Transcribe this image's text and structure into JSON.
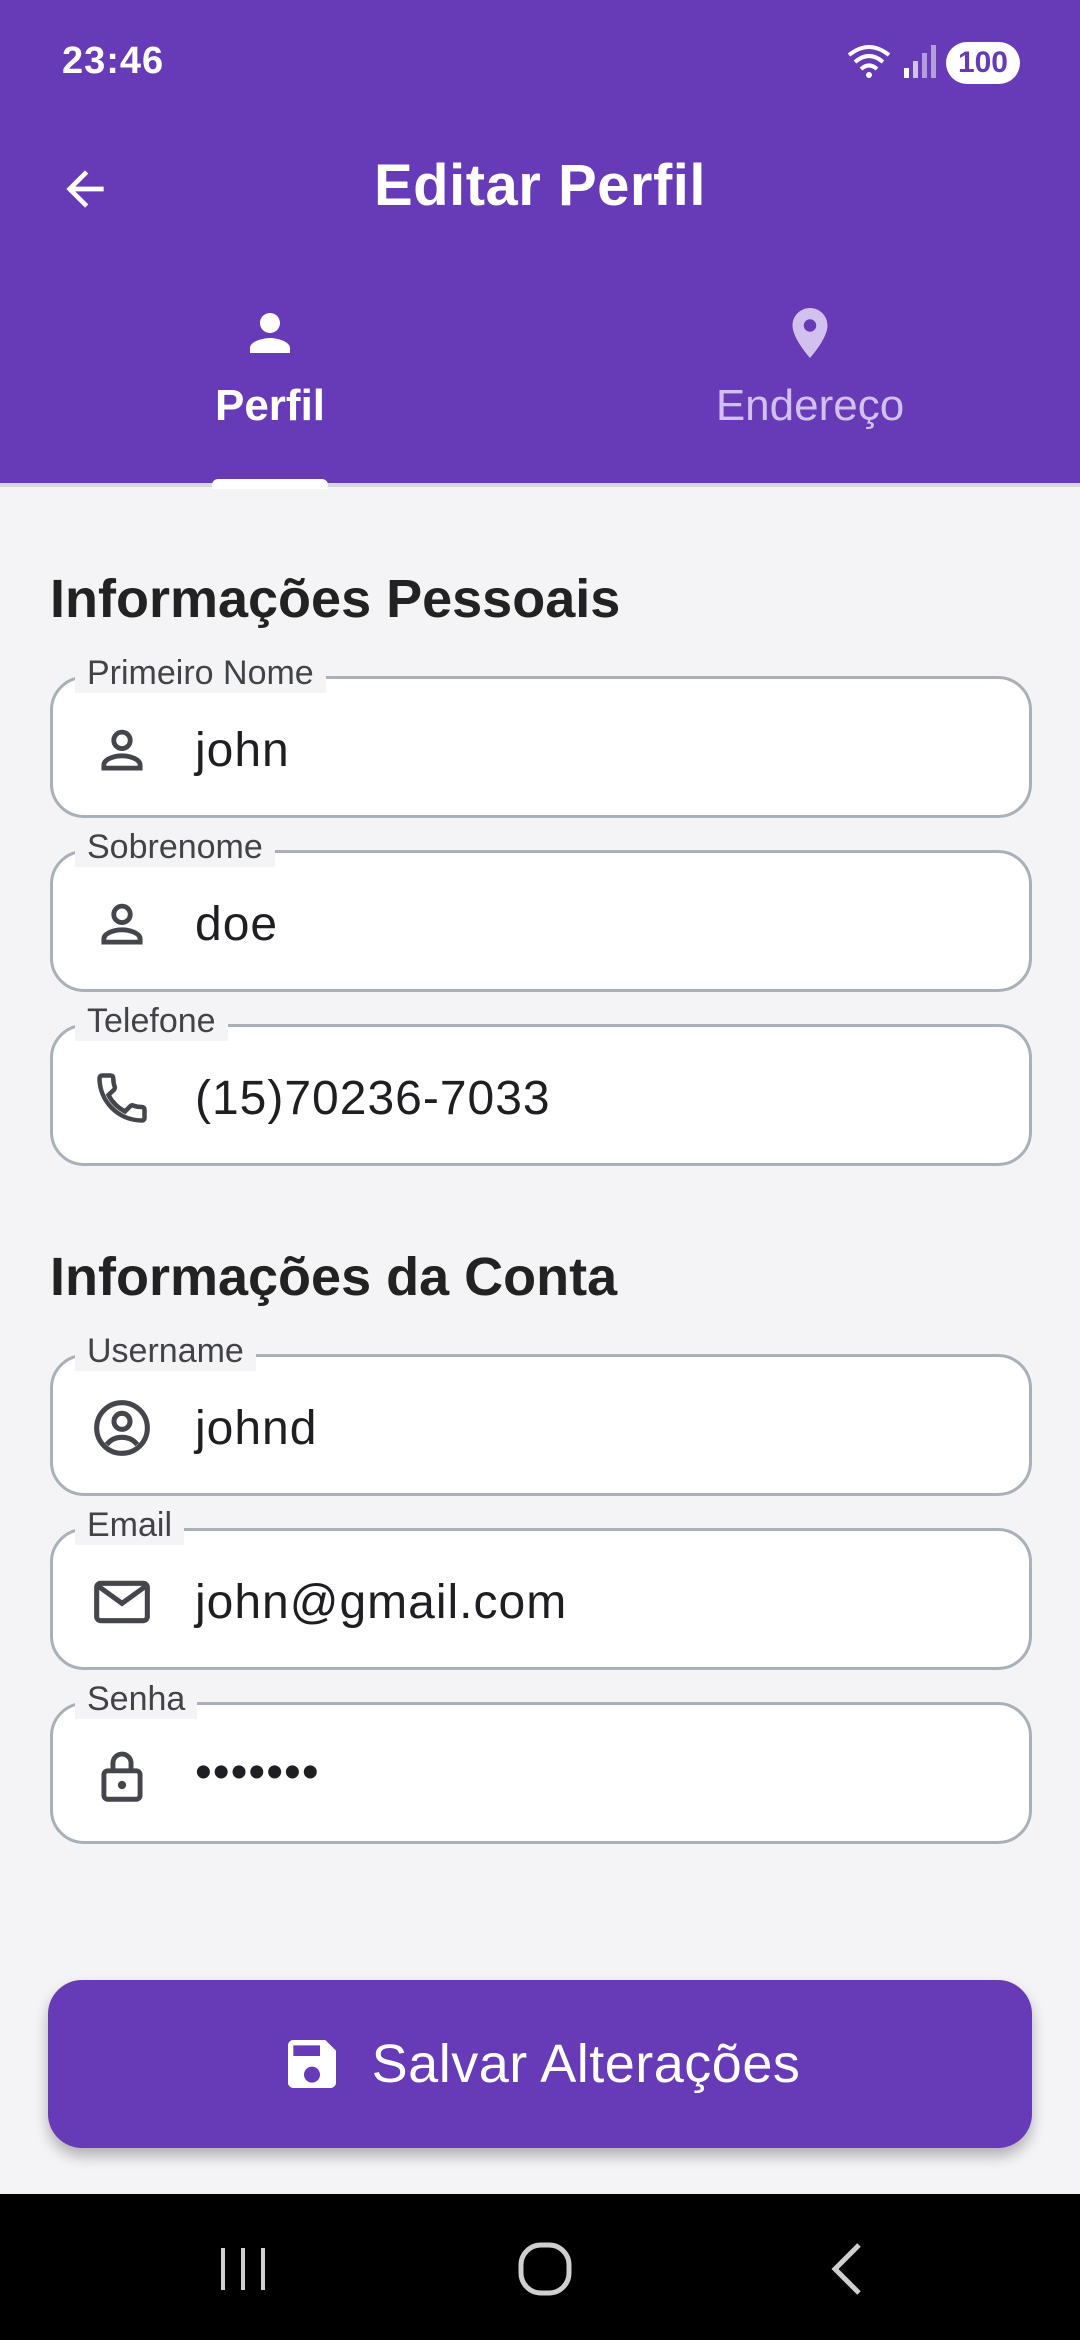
{
  "status_bar": {
    "time": "23:46",
    "battery": "100"
  },
  "app_bar": {
    "title": "Editar Perfil"
  },
  "tabs": [
    {
      "label": "Perfil",
      "icon": "person-icon",
      "active": true
    },
    {
      "label": "Endereço",
      "icon": "location-pin-icon",
      "active": false
    }
  ],
  "sections": {
    "personal": "Informações Pessoais",
    "account": "Informações da Conta"
  },
  "fields": {
    "first_name": {
      "label": "Primeiro Nome",
      "value": "john",
      "icon": "person-outline-icon"
    },
    "last_name": {
      "label": "Sobrenome",
      "value": "doe",
      "icon": "person-outline-icon"
    },
    "phone": {
      "label": "Telefone",
      "value": "(15)70236-7033",
      "icon": "phone-icon"
    },
    "username": {
      "label": "Username",
      "value": "johnd",
      "icon": "account-circle-icon"
    },
    "email": {
      "label": "Email",
      "value": "john@gmail.com",
      "icon": "mail-icon"
    },
    "password": {
      "label": "Senha",
      "value": "•••••••",
      "icon": "lock-icon"
    }
  },
  "save_button": {
    "label": "Salvar Alterações",
    "icon": "save-icon"
  },
  "colors": {
    "primary": "#673ab7",
    "background": "#f4f4f6",
    "border": "#a9b0b8"
  }
}
